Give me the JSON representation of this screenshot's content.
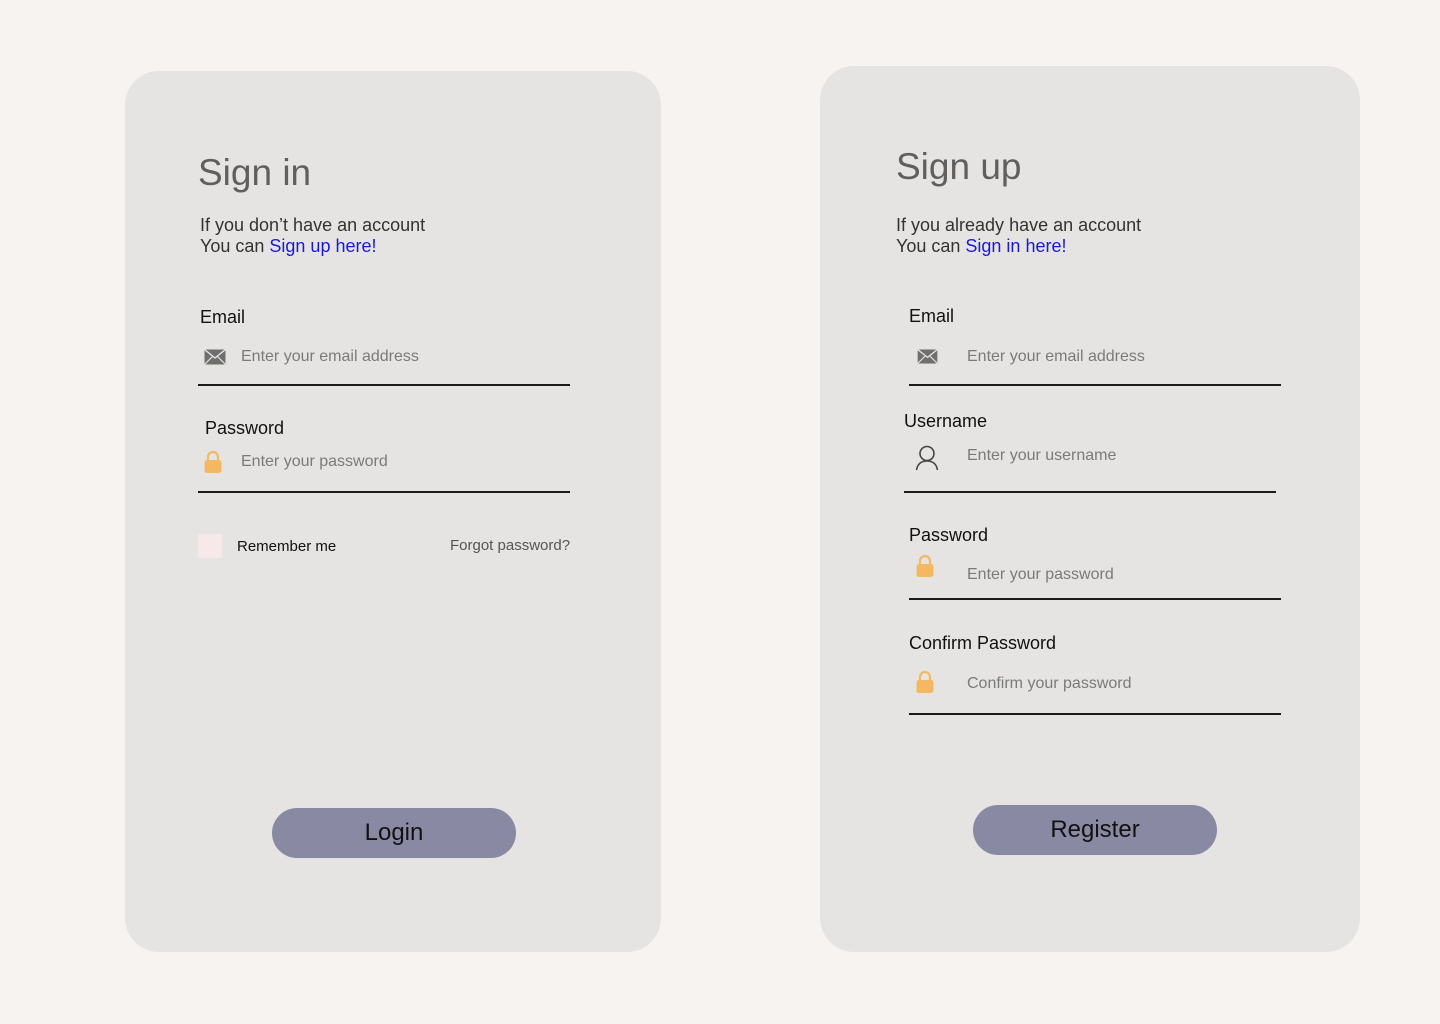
{
  "signin": {
    "title": "Sign in",
    "subtitle_line1": "If you don’t have an account",
    "subtitle_prefix": "You can ",
    "subtitle_link": "Sign up here!",
    "email": {
      "label": "Email",
      "placeholder": "Enter your email address",
      "icon": "mail-icon"
    },
    "password": {
      "label": "Password",
      "placeholder": "Enter your password",
      "icon": "lock-icon"
    },
    "remember_label": "Remember me",
    "forgot_label": "Forgot password?",
    "button_label": "Login"
  },
  "signup": {
    "title": "Sign up",
    "subtitle_line1": "If you already have an account",
    "subtitle_prefix": "You can ",
    "subtitle_link": "Sign in here!",
    "email": {
      "label": "Email",
      "placeholder": "Enter your email address",
      "icon": "mail-icon"
    },
    "username": {
      "label": "Username",
      "placeholder": "Enter your username",
      "icon": "user-icon"
    },
    "password": {
      "label": "Password",
      "placeholder": "Enter your password",
      "icon": "lock-icon"
    },
    "confirm": {
      "label": "Confirm Password",
      "placeholder": "Confirm your password",
      "icon": "lock-icon"
    },
    "button_label": "Register"
  },
  "colors": {
    "page_bg": "#f6f3f1",
    "card_bg": "#e6e4e2",
    "link": "#1a1ad6",
    "button": "#8a89a3",
    "lock": "#f4b862",
    "checkbox": "#f7e9ea"
  }
}
